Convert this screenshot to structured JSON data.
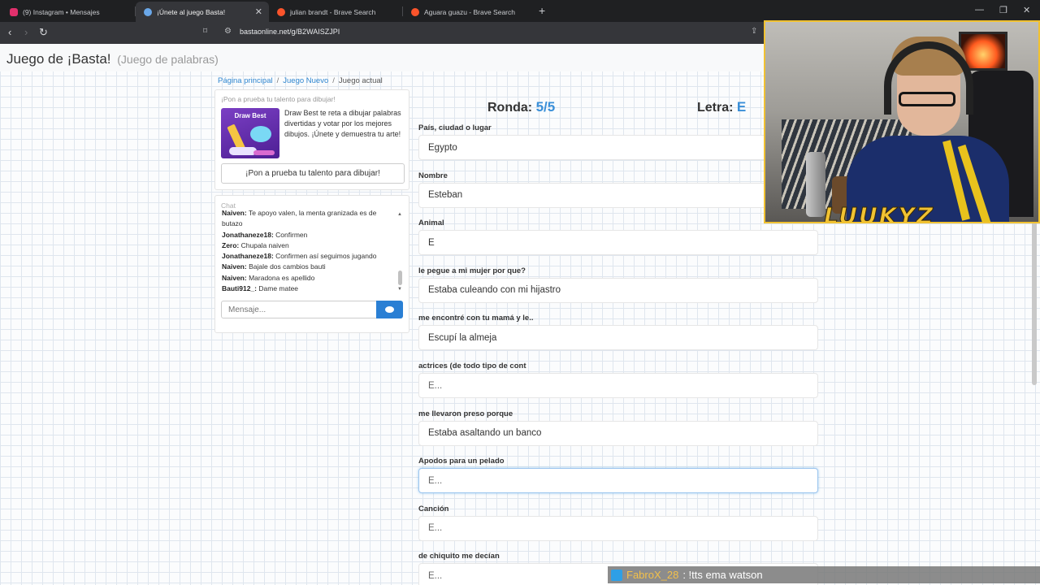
{
  "browser": {
    "tabs": [
      {
        "title": "(9) Instagram • Mensajes",
        "active": false,
        "color": "#e1306c"
      },
      {
        "title": "¡Únete al juego Basta!",
        "active": true,
        "color": "#6aa7e8"
      },
      {
        "title": "julian brandt - Brave Search",
        "active": false,
        "color": "#fb542b"
      },
      {
        "title": "Aguara guazu - Brave Search",
        "active": false,
        "color": "#fb542b"
      }
    ],
    "url": "bastaonline.net/g/B2WAISZJPI"
  },
  "header": {
    "title": "Juego de ¡Basta!",
    "subtitle": "(Juego de palabras)"
  },
  "breadcrumb": {
    "home": "Página principal",
    "new_game": "Juego Nuevo",
    "current": "Juego actual"
  },
  "promo": {
    "title": "¡Pon a prueba tu talento para dibujar!",
    "image_title": "Draw Best",
    "text": "Draw Best te reta a dibujar palabras divertidas y votar por los mejores dibujos. ¡Únete y demuestra tu arte!",
    "button": "¡Pon a prueba tu talento para dibujar!"
  },
  "chat": {
    "title": "Chat",
    "messages": [
      {
        "user": "Naiven:",
        "text": "Te apoyo valen, la menta granizada es de butazo"
      },
      {
        "user": "Jonathaneze18:",
        "text": "Confirmen"
      },
      {
        "user": "Zero:",
        "text": "Chupala naiven"
      },
      {
        "user": "Jonathaneze18:",
        "text": "Confirmen así seguimos jugando"
      },
      {
        "user": "Naiven:",
        "text": "Bajale dos cambios bauti"
      },
      {
        "user": "Naiven:",
        "text": "Maradona es apellido"
      },
      {
        "user": "Bauti912_:",
        "text": "Dame matee"
      }
    ],
    "input_placeholder": "Mensaje..."
  },
  "game": {
    "round_label": "Ronda:",
    "round_value": "5/5",
    "letter_label": "Letra:",
    "letter_value": "E",
    "fields": [
      {
        "label": "País, ciudad o lugar",
        "value": "Egypto",
        "placeholder": "E..."
      },
      {
        "label": "Nombre",
        "value": "Esteban",
        "placeholder": "E..."
      },
      {
        "label": "Animal",
        "value": "E",
        "placeholder": "E..."
      },
      {
        "label": "le pegue a mi mujer por que?",
        "value": "Estaba culeando con mi hijastro",
        "placeholder": "E..."
      },
      {
        "label": "me encontré con tu mamá y le..",
        "value": "Escupí la almeja",
        "placeholder": "E..."
      },
      {
        "label": "actrices (de todo tipo de cont",
        "value": "",
        "placeholder": "E..."
      },
      {
        "label": "me llevaron preso porque",
        "value": "Estaba asaltando un banco",
        "placeholder": "E..."
      },
      {
        "label": "Apodos para un pelado",
        "value": "",
        "placeholder": "E..."
      },
      {
        "label": "Canción",
        "value": "",
        "placeholder": "E..."
      },
      {
        "label": "de chiquito me decían",
        "value": "",
        "placeholder": "E..."
      }
    ]
  },
  "overlay": {
    "streamer_name": "LUUKYZ",
    "tts_user": "FabroX_28",
    "tts_message": ": !tts ema watson"
  },
  "colors": {
    "accent": "#3a8fd8",
    "link": "#2f86d0",
    "send_button": "#2a7fd4",
    "overlay_gold": "#f1c232"
  }
}
